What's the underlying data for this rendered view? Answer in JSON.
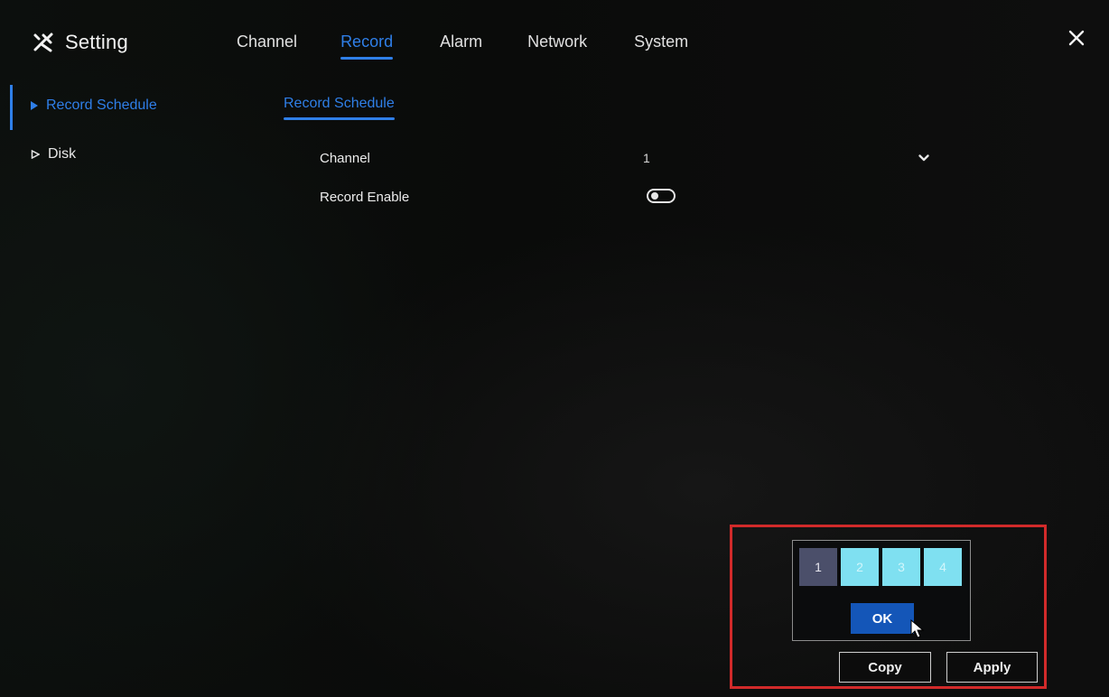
{
  "app": {
    "title": "Setting",
    "icon": "tools-icon"
  },
  "tabs": [
    {
      "label": "Channel",
      "active": false
    },
    {
      "label": "Record",
      "active": true
    },
    {
      "label": "Alarm",
      "active": false
    },
    {
      "label": "Network",
      "active": false
    },
    {
      "label": "System",
      "active": false
    }
  ],
  "sidebar": {
    "items": [
      {
        "label": "Record Schedule",
        "active": true,
        "icon": "triangle-filled-icon"
      },
      {
        "label": "Disk",
        "active": false,
        "icon": "triangle-outline-icon"
      }
    ]
  },
  "subtab": {
    "label": "Record Schedule"
  },
  "form": {
    "channel_label": "Channel",
    "channel_value": "1",
    "record_enable_label": "Record Enable",
    "record_enable_on": false
  },
  "copy_panel": {
    "channels": [
      {
        "label": "1",
        "selected": false
      },
      {
        "label": "2",
        "selected": true
      },
      {
        "label": "3",
        "selected": true
      },
      {
        "label": "4",
        "selected": true
      }
    ],
    "ok_label": "OK"
  },
  "buttons": {
    "copy_label": "Copy",
    "apply_label": "Apply"
  },
  "colors": {
    "accent": "#2f7fe8",
    "highlight": "#d12a2a",
    "ok_button": "#1456b8",
    "channel_selected": "#7fe0f1",
    "channel_current": "#4b4f6a"
  }
}
